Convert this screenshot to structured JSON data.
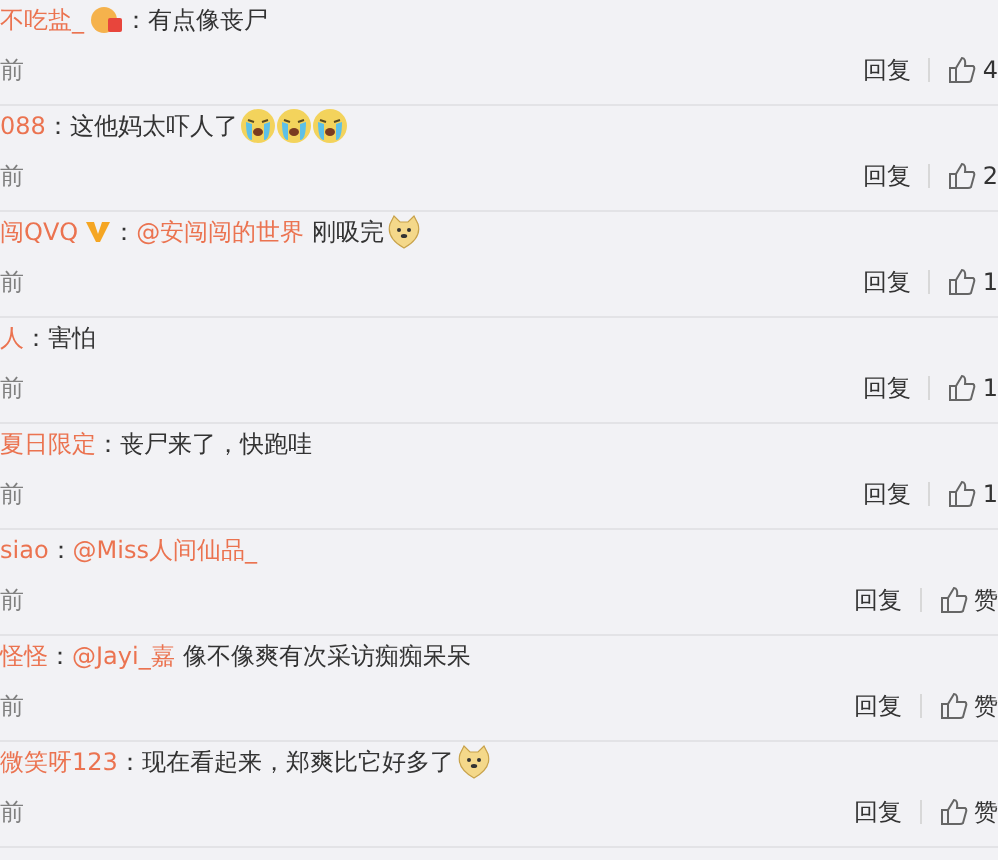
{
  "comments": [
    {
      "name": "不吃盐_",
      "badge": {
        "kind": "medal"
      },
      "colon": "：",
      "parts": [
        {
          "kind": "text",
          "text": "有点像丧尸"
        }
      ],
      "time": "前",
      "reply": "回复",
      "likes": "4"
    },
    {
      "name": "088",
      "colon": "：",
      "parts": [
        {
          "kind": "text",
          "text": "这他妈太吓人了"
        },
        {
          "kind": "crying-emoji"
        },
        {
          "kind": "crying-emoji"
        },
        {
          "kind": "crying-emoji"
        }
      ],
      "time": "前",
      "reply": "回复",
      "likes": "2"
    },
    {
      "name": "闯QVQ",
      "badge": {
        "kind": "verified"
      },
      "colon": "：",
      "parts": [
        {
          "kind": "mention",
          "text": "@安闯闯的世界"
        },
        {
          "kind": "text",
          "text": "刚吸完"
        },
        {
          "kind": "dog-emoji"
        }
      ],
      "time": "前",
      "reply": "回复",
      "likes": "1"
    },
    {
      "name": "人",
      "colon": "：",
      "parts": [
        {
          "kind": "text",
          "text": "害怕"
        }
      ],
      "time": "前",
      "reply": "回复",
      "likes": "1"
    },
    {
      "name": "夏日限定",
      "colon": "：",
      "parts": [
        {
          "kind": "text",
          "text": "丧尸来了，快跑哇"
        }
      ],
      "time": "前",
      "reply": "回复",
      "likes": "1"
    },
    {
      "name": "siao",
      "colon": "：",
      "parts": [
        {
          "kind": "mention",
          "text": "@Miss人间仙品_"
        }
      ],
      "time": "前",
      "reply": "回复",
      "likes": "赞"
    },
    {
      "name": "怪怪",
      "colon": "：",
      "parts": [
        {
          "kind": "mention",
          "text": "@Jayi_嘉"
        },
        {
          "kind": "text",
          "text": "像不像爽有次采访痴痴呆呆"
        }
      ],
      "time": "前",
      "reply": "回复",
      "likes": "赞"
    },
    {
      "name": "微笑呀123",
      "colon": "：",
      "parts": [
        {
          "kind": "text",
          "text": "现在看起来，郑爽比它好多了"
        },
        {
          "kind": "dog-emoji"
        }
      ],
      "time": "前",
      "reply": "回复",
      "likes": "赞"
    }
  ]
}
